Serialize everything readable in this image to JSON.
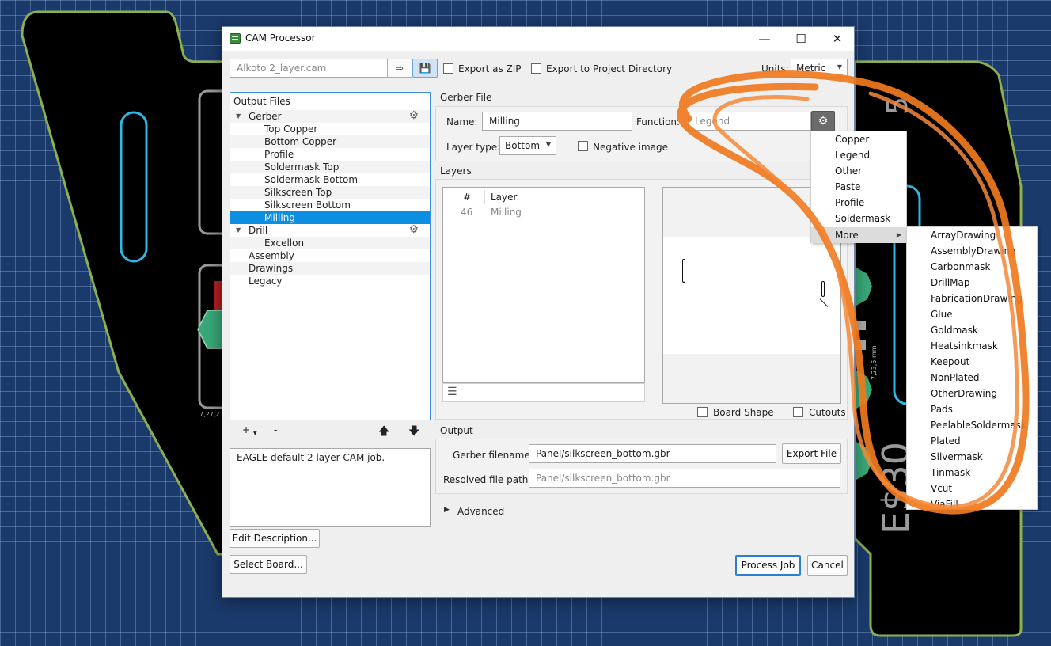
{
  "window": {
    "title": "CAM Processor"
  },
  "toolbar": {
    "job_file": "Alkoto 2_layer.cam",
    "export_zip": "Export as ZIP",
    "export_project": "Export to Project Directory",
    "units_label": "Units:",
    "units_value": "Metric"
  },
  "output_files": {
    "header": "Output Files",
    "items": [
      {
        "label": "Gerber",
        "kind": "group"
      },
      {
        "label": "Top Copper",
        "kind": "child"
      },
      {
        "label": "Bottom Copper",
        "kind": "child"
      },
      {
        "label": "Profile",
        "kind": "child"
      },
      {
        "label": "Soldermask Top",
        "kind": "child"
      },
      {
        "label": "Soldermask Bottom",
        "kind": "child"
      },
      {
        "label": "Silkscreen Top",
        "kind": "child"
      },
      {
        "label": "Silkscreen Bottom",
        "kind": "child"
      },
      {
        "label": "Milling",
        "kind": "child",
        "selected": true
      },
      {
        "label": "Drill",
        "kind": "group"
      },
      {
        "label": "Excellon",
        "kind": "child"
      },
      {
        "label": "Assembly",
        "kind": "top"
      },
      {
        "label": "Drawings",
        "kind": "top"
      },
      {
        "label": "Legacy",
        "kind": "top"
      }
    ],
    "add": "+",
    "remove": "-"
  },
  "description": "EAGLE default 2 layer CAM job.",
  "buttons": {
    "edit_description": "Edit Description...",
    "select_board": "Select Board...",
    "process_job": "Process Job",
    "cancel": "Cancel",
    "export_file": "Export File"
  },
  "gerber_file": {
    "section": "Gerber File",
    "name_label": "Name:",
    "name_value": "Milling",
    "function_label": "Function:",
    "function_placeholder": "Legend",
    "layer_type_label": "Layer type:",
    "layer_type_value": "Bottom",
    "negative_image": "Negative image"
  },
  "layers": {
    "section": "Layers",
    "col_num": "#",
    "col_layer": "Layer",
    "rows": [
      {
        "num": "46",
        "name": "Milling"
      }
    ],
    "board_shape": "Board Shape",
    "cutouts": "Cutouts"
  },
  "output": {
    "section": "Output",
    "gerber_filename_label": "Gerber filename:",
    "gerber_filename_value": "Panel/silkscreen_bottom.gbr",
    "resolved_label": "Resolved file path:",
    "resolved_value": "Panel/silkscreen_bottom.gbr"
  },
  "advanced": "Advanced",
  "function_menu": {
    "items": [
      "Copper",
      "Legend",
      "Other",
      "Paste",
      "Profile",
      "Soldermask"
    ],
    "more": "More"
  },
  "more_menu": {
    "items": [
      "ArrayDrawing",
      "AssemblyDrawing",
      "Carbonmask",
      "DrillMap",
      "FabricationDrawing",
      "Glue",
      "Goldmask",
      "Heatsinkmask",
      "Keepout",
      "NonPlated",
      "OtherDrawing",
      "Pads",
      "PeelableSoldermask",
      "Plated",
      "Silvermask",
      "Tinmask",
      "Vcut",
      "ViaFill"
    ]
  },
  "background": {
    "silk_left": "7,27,2",
    "silk_right": "7,23,5 mm",
    "silk_big": "E$30",
    "silk_big2": "5"
  },
  "colors": {
    "accent": "#0c8fe0",
    "annotation": "#f07a20",
    "board_outline": "#8db04a",
    "slot": "#2db8e8"
  }
}
